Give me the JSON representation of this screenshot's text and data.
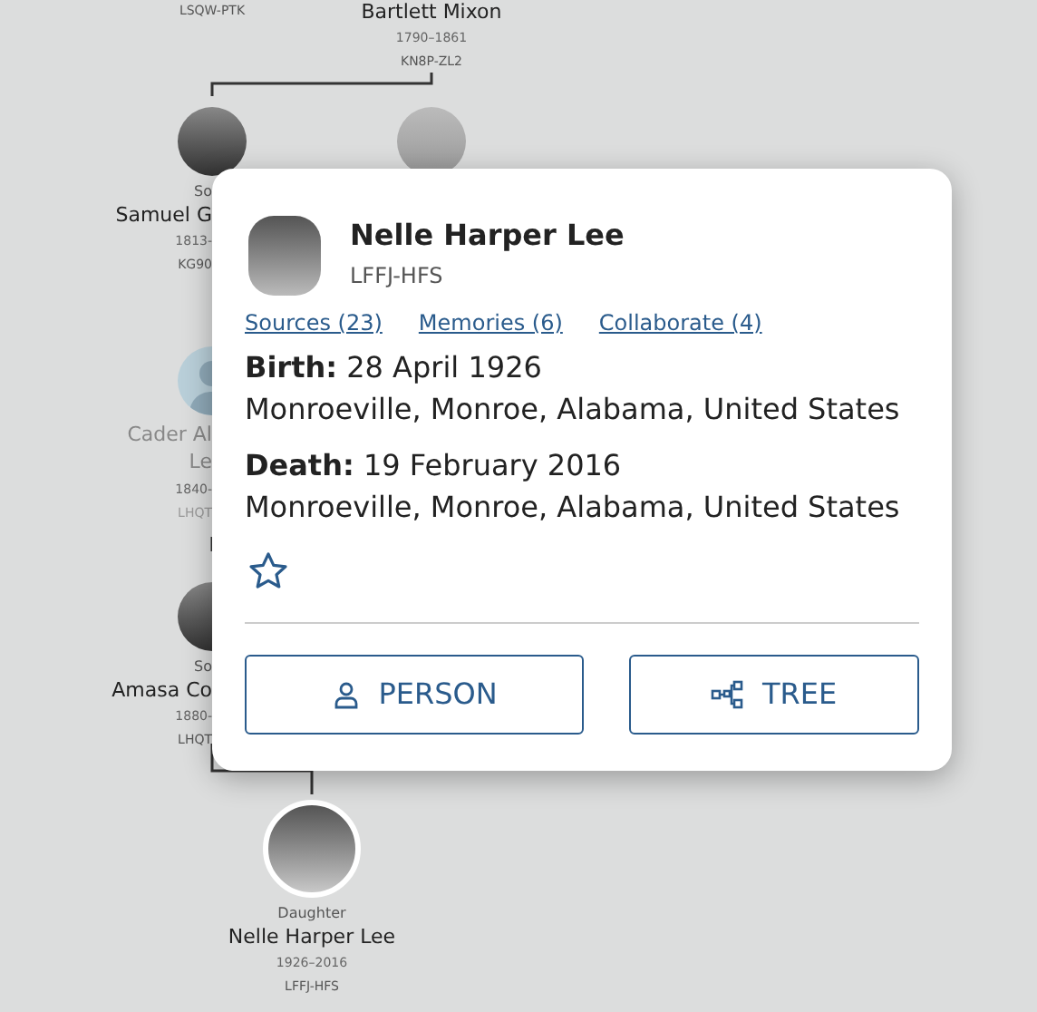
{
  "tree": {
    "nodes": [
      {
        "kind": "text-only",
        "lines": [
          {
            "kind": "id",
            "text": "LSQW-PTK"
          }
        ]
      },
      {
        "kind": "text-only",
        "lines": [
          {
            "kind": "name",
            "text": "Bartlett Mixon"
          },
          {
            "kind": "dates",
            "text": "1790–1861"
          },
          {
            "kind": "id",
            "text": "KN8P-ZL2"
          }
        ]
      },
      {
        "kind": "photo",
        "lines": [
          {
            "kind": "relation",
            "text": "So"
          },
          {
            "kind": "name",
            "text": "Samuel G"
          },
          {
            "kind": "dates",
            "text": "1813-"
          },
          {
            "kind": "id",
            "text": "KG90"
          }
        ]
      },
      {
        "kind": "photo"
      },
      {
        "kind": "silhouette",
        "disabled": true,
        "lines": [
          {
            "kind": "name",
            "text": "Cader Al"
          },
          {
            "kind": "name",
            "text": "Le"
          },
          {
            "kind": "dates",
            "text": "1840-"
          },
          {
            "kind": "id",
            "text": "LHQT"
          }
        ]
      },
      {
        "kind": "photo",
        "lines": [
          {
            "kind": "relation",
            "text": "So"
          },
          {
            "kind": "name",
            "text": "Amasa Co"
          },
          {
            "kind": "dates",
            "text": "1880-"
          },
          {
            "kind": "id",
            "text": "LHQT"
          }
        ]
      },
      {
        "kind": "focus",
        "lines": [
          {
            "kind": "relation",
            "text": "Daughter"
          },
          {
            "kind": "name",
            "text": "Nelle Harper Lee"
          },
          {
            "kind": "dates",
            "text": "1926–2016"
          },
          {
            "kind": "id",
            "text": "LFFJ-HFS"
          }
        ]
      }
    ]
  },
  "popup": {
    "name": "Nelle Harper Lee",
    "id": "LFFJ-HFS",
    "links": [
      "Sources (23)",
      "Memories (6)",
      "Collaborate (4)"
    ],
    "events": [
      {
        "label": "Birth:",
        "date": "28 April 1926",
        "place": "Monroeville, Monroe, Alabama, United States"
      },
      {
        "label": "Death:",
        "date": "19 February 2016",
        "place": "Monroeville, Monroe, Alabama, United States"
      }
    ],
    "favorite": false,
    "buttons": [
      {
        "kind": "person",
        "label": "PERSON"
      },
      {
        "kind": "tree",
        "label": "TREE"
      }
    ]
  }
}
